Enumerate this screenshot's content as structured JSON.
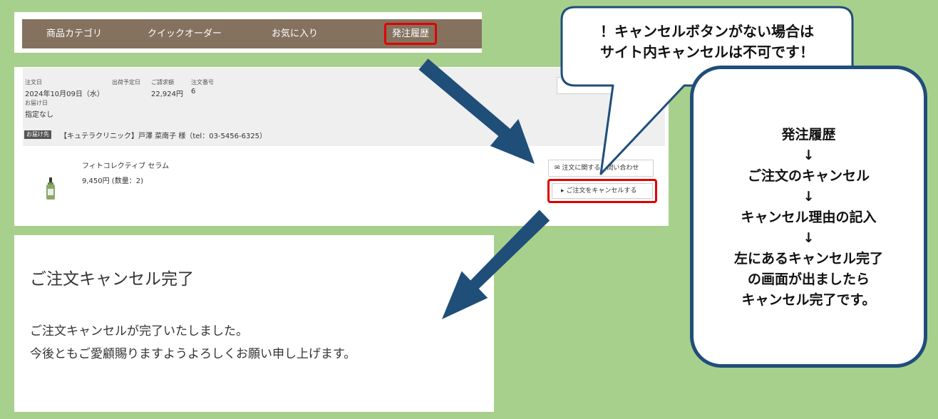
{
  "nav": {
    "items": [
      "商品カテゴリ",
      "クイックオーダー",
      "お気に入り"
    ],
    "history_label": "発注履歴"
  },
  "order": {
    "labels": {
      "order_date": "注文日",
      "ship_date": "出荷予定日",
      "billed": "ご請求額",
      "order_no": "注文番号",
      "delivery_date": "お届け日",
      "ship_to": "お届け先"
    },
    "order_date": "2024年10月09日（水）",
    "billed": "22,924円",
    "order_no": "6",
    "delivery_date": "指定なし",
    "ship_to_text": "【キュテラクリニック】戸澤 菜南子 様（tel：03-5456-6325）",
    "product_name": "フィトコレクティブ セラム",
    "product_price": "9,450円 (数量：2)",
    "contact_button": "注文に関するお問い合わせ",
    "cancel_button": "ご注文をキャンセルする"
  },
  "done": {
    "title": "ご注文キャンセル完了",
    "line1": "ご注文キャンセルが完了いたしました。",
    "line2": "今後ともご愛顧賜りますようよろしくお願い申し上げます。"
  },
  "callout": {
    "line1": "！キャンセルボタンがない場合は",
    "line2": "サイト内キャンセルは不可です！"
  },
  "steps": [
    "発注履歴",
    "↓",
    "ご注文のキャンセル",
    "↓",
    "キャンセル理由の記入",
    "↓",
    "左にあるキャンセル完了",
    "の画面が出ましたら",
    "キャンセル完了です。"
  ],
  "colors": {
    "background": "#a8d08d",
    "nav_bar": "#84725f",
    "highlight": "#e00000",
    "arrow": "#1f4e79"
  }
}
